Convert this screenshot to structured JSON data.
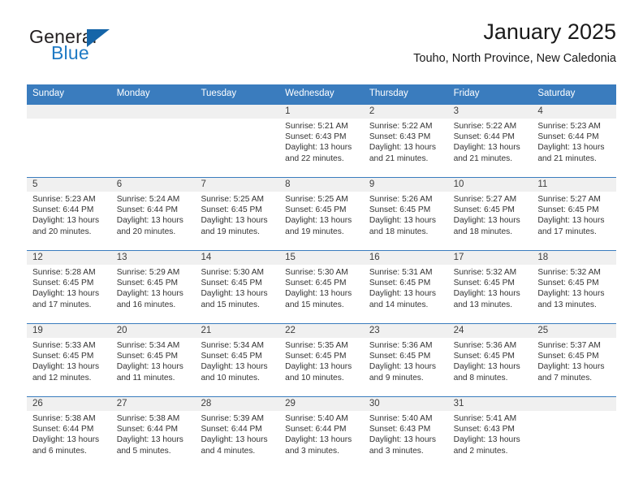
{
  "brand": {
    "name_part1": "General",
    "name_part2": "Blue",
    "accent_color": "#1f7ac4",
    "logo_triangle_color": "#1565a8"
  },
  "header": {
    "title": "January 2025",
    "subtitle": "Touho, North Province, New Caledonia"
  },
  "calendar": {
    "header_bg": "#3a7cbe",
    "weekdays": [
      "Sunday",
      "Monday",
      "Tuesday",
      "Wednesday",
      "Thursday",
      "Friday",
      "Saturday"
    ],
    "weeks": [
      [
        {
          "day": "",
          "sunrise": "",
          "sunset": "",
          "daylight_line1": "",
          "daylight_line2": ""
        },
        {
          "day": "",
          "sunrise": "",
          "sunset": "",
          "daylight_line1": "",
          "daylight_line2": ""
        },
        {
          "day": "",
          "sunrise": "",
          "sunset": "",
          "daylight_line1": "",
          "daylight_line2": ""
        },
        {
          "day": "1",
          "sunrise": "Sunrise: 5:21 AM",
          "sunset": "Sunset: 6:43 PM",
          "daylight_line1": "Daylight: 13 hours",
          "daylight_line2": "and 22 minutes."
        },
        {
          "day": "2",
          "sunrise": "Sunrise: 5:22 AM",
          "sunset": "Sunset: 6:43 PM",
          "daylight_line1": "Daylight: 13 hours",
          "daylight_line2": "and 21 minutes."
        },
        {
          "day": "3",
          "sunrise": "Sunrise: 5:22 AM",
          "sunset": "Sunset: 6:44 PM",
          "daylight_line1": "Daylight: 13 hours",
          "daylight_line2": "and 21 minutes."
        },
        {
          "day": "4",
          "sunrise": "Sunrise: 5:23 AM",
          "sunset": "Sunset: 6:44 PM",
          "daylight_line1": "Daylight: 13 hours",
          "daylight_line2": "and 21 minutes."
        }
      ],
      [
        {
          "day": "5",
          "sunrise": "Sunrise: 5:23 AM",
          "sunset": "Sunset: 6:44 PM",
          "daylight_line1": "Daylight: 13 hours",
          "daylight_line2": "and 20 minutes."
        },
        {
          "day": "6",
          "sunrise": "Sunrise: 5:24 AM",
          "sunset": "Sunset: 6:44 PM",
          "daylight_line1": "Daylight: 13 hours",
          "daylight_line2": "and 20 minutes."
        },
        {
          "day": "7",
          "sunrise": "Sunrise: 5:25 AM",
          "sunset": "Sunset: 6:45 PM",
          "daylight_line1": "Daylight: 13 hours",
          "daylight_line2": "and 19 minutes."
        },
        {
          "day": "8",
          "sunrise": "Sunrise: 5:25 AM",
          "sunset": "Sunset: 6:45 PM",
          "daylight_line1": "Daylight: 13 hours",
          "daylight_line2": "and 19 minutes."
        },
        {
          "day": "9",
          "sunrise": "Sunrise: 5:26 AM",
          "sunset": "Sunset: 6:45 PM",
          "daylight_line1": "Daylight: 13 hours",
          "daylight_line2": "and 18 minutes."
        },
        {
          "day": "10",
          "sunrise": "Sunrise: 5:27 AM",
          "sunset": "Sunset: 6:45 PM",
          "daylight_line1": "Daylight: 13 hours",
          "daylight_line2": "and 18 minutes."
        },
        {
          "day": "11",
          "sunrise": "Sunrise: 5:27 AM",
          "sunset": "Sunset: 6:45 PM",
          "daylight_line1": "Daylight: 13 hours",
          "daylight_line2": "and 17 minutes."
        }
      ],
      [
        {
          "day": "12",
          "sunrise": "Sunrise: 5:28 AM",
          "sunset": "Sunset: 6:45 PM",
          "daylight_line1": "Daylight: 13 hours",
          "daylight_line2": "and 17 minutes."
        },
        {
          "day": "13",
          "sunrise": "Sunrise: 5:29 AM",
          "sunset": "Sunset: 6:45 PM",
          "daylight_line1": "Daylight: 13 hours",
          "daylight_line2": "and 16 minutes."
        },
        {
          "day": "14",
          "sunrise": "Sunrise: 5:30 AM",
          "sunset": "Sunset: 6:45 PM",
          "daylight_line1": "Daylight: 13 hours",
          "daylight_line2": "and 15 minutes."
        },
        {
          "day": "15",
          "sunrise": "Sunrise: 5:30 AM",
          "sunset": "Sunset: 6:45 PM",
          "daylight_line1": "Daylight: 13 hours",
          "daylight_line2": "and 15 minutes."
        },
        {
          "day": "16",
          "sunrise": "Sunrise: 5:31 AM",
          "sunset": "Sunset: 6:45 PM",
          "daylight_line1": "Daylight: 13 hours",
          "daylight_line2": "and 14 minutes."
        },
        {
          "day": "17",
          "sunrise": "Sunrise: 5:32 AM",
          "sunset": "Sunset: 6:45 PM",
          "daylight_line1": "Daylight: 13 hours",
          "daylight_line2": "and 13 minutes."
        },
        {
          "day": "18",
          "sunrise": "Sunrise: 5:32 AM",
          "sunset": "Sunset: 6:45 PM",
          "daylight_line1": "Daylight: 13 hours",
          "daylight_line2": "and 13 minutes."
        }
      ],
      [
        {
          "day": "19",
          "sunrise": "Sunrise: 5:33 AM",
          "sunset": "Sunset: 6:45 PM",
          "daylight_line1": "Daylight: 13 hours",
          "daylight_line2": "and 12 minutes."
        },
        {
          "day": "20",
          "sunrise": "Sunrise: 5:34 AM",
          "sunset": "Sunset: 6:45 PM",
          "daylight_line1": "Daylight: 13 hours",
          "daylight_line2": "and 11 minutes."
        },
        {
          "day": "21",
          "sunrise": "Sunrise: 5:34 AM",
          "sunset": "Sunset: 6:45 PM",
          "daylight_line1": "Daylight: 13 hours",
          "daylight_line2": "and 10 minutes."
        },
        {
          "day": "22",
          "sunrise": "Sunrise: 5:35 AM",
          "sunset": "Sunset: 6:45 PM",
          "daylight_line1": "Daylight: 13 hours",
          "daylight_line2": "and 10 minutes."
        },
        {
          "day": "23",
          "sunrise": "Sunrise: 5:36 AM",
          "sunset": "Sunset: 6:45 PM",
          "daylight_line1": "Daylight: 13 hours",
          "daylight_line2": "and 9 minutes."
        },
        {
          "day": "24",
          "sunrise": "Sunrise: 5:36 AM",
          "sunset": "Sunset: 6:45 PM",
          "daylight_line1": "Daylight: 13 hours",
          "daylight_line2": "and 8 minutes."
        },
        {
          "day": "25",
          "sunrise": "Sunrise: 5:37 AM",
          "sunset": "Sunset: 6:45 PM",
          "daylight_line1": "Daylight: 13 hours",
          "daylight_line2": "and 7 minutes."
        }
      ],
      [
        {
          "day": "26",
          "sunrise": "Sunrise: 5:38 AM",
          "sunset": "Sunset: 6:44 PM",
          "daylight_line1": "Daylight: 13 hours",
          "daylight_line2": "and 6 minutes."
        },
        {
          "day": "27",
          "sunrise": "Sunrise: 5:38 AM",
          "sunset": "Sunset: 6:44 PM",
          "daylight_line1": "Daylight: 13 hours",
          "daylight_line2": "and 5 minutes."
        },
        {
          "day": "28",
          "sunrise": "Sunrise: 5:39 AM",
          "sunset": "Sunset: 6:44 PM",
          "daylight_line1": "Daylight: 13 hours",
          "daylight_line2": "and 4 minutes."
        },
        {
          "day": "29",
          "sunrise": "Sunrise: 5:40 AM",
          "sunset": "Sunset: 6:44 PM",
          "daylight_line1": "Daylight: 13 hours",
          "daylight_line2": "and 3 minutes."
        },
        {
          "day": "30",
          "sunrise": "Sunrise: 5:40 AM",
          "sunset": "Sunset: 6:43 PM",
          "daylight_line1": "Daylight: 13 hours",
          "daylight_line2": "and 3 minutes."
        },
        {
          "day": "31",
          "sunrise": "Sunrise: 5:41 AM",
          "sunset": "Sunset: 6:43 PM",
          "daylight_line1": "Daylight: 13 hours",
          "daylight_line2": "and 2 minutes."
        },
        {
          "day": "",
          "sunrise": "",
          "sunset": "",
          "daylight_line1": "",
          "daylight_line2": ""
        }
      ]
    ]
  }
}
